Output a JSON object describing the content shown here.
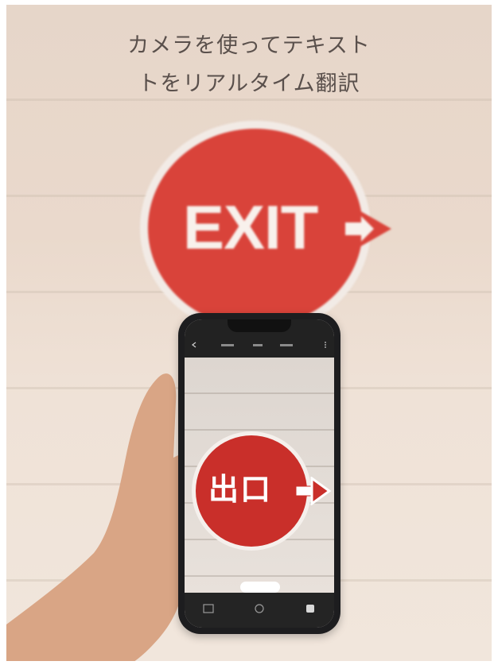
{
  "headline": {
    "line1": "カメラを使ってテキスト",
    "line2": "トをリアルタイム翻訳"
  },
  "sign": {
    "text": "EXIT",
    "color": "#d9433a"
  },
  "phone": {
    "translated_text": "出口",
    "icons": [
      "back-icon",
      "gallery-icon",
      "capture-icon",
      "settings-icon"
    ]
  },
  "colors": {
    "sign_red": "#d9433a",
    "phone_body": "#1d1d1f",
    "wall": "#ead9cc"
  }
}
